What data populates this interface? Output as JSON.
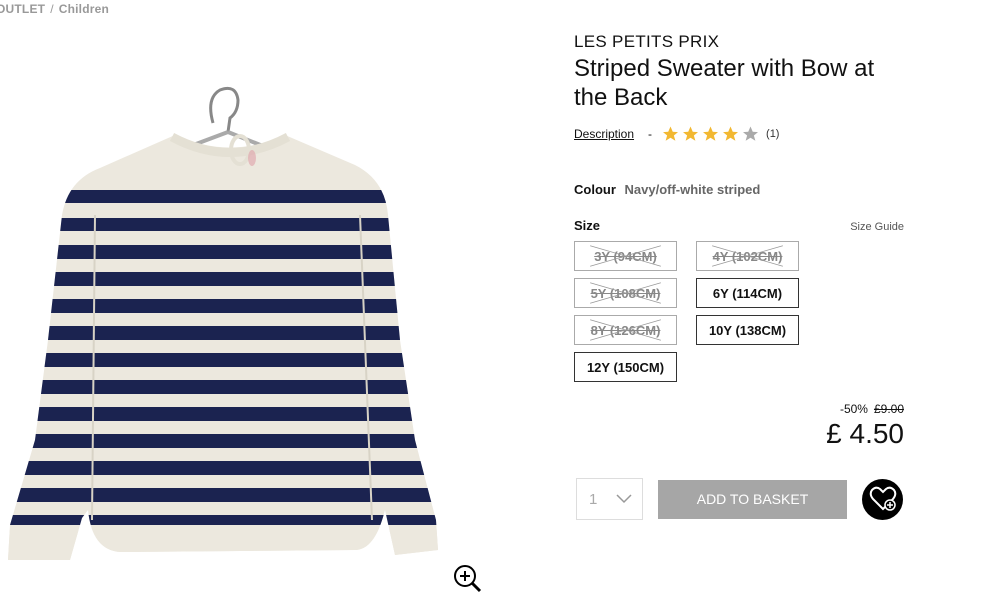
{
  "breadcrumb": {
    "items": [
      "OUTLET",
      "Children"
    ],
    "separator": "/"
  },
  "product": {
    "brand": "LES PETITS PRIX",
    "title": "Striped Sweater with Bow at the Back",
    "description_link": "Description",
    "dash": "-",
    "rating": {
      "stars": 4,
      "max": 5,
      "count_text": "(1)"
    },
    "colour": {
      "label": "Colour",
      "value": "Navy/off-white striped"
    },
    "size": {
      "label": "Size",
      "guide": "Size Guide",
      "options": [
        {
          "label": "3Y (94CM)",
          "available": false
        },
        {
          "label": "4Y (102CM)",
          "available": false
        },
        {
          "label": "5Y (108CM)",
          "available": false
        },
        {
          "label": "6Y (114CM)",
          "available": true
        },
        {
          "label": "8Y (126CM)",
          "available": false
        },
        {
          "label": "10Y (138CM)",
          "available": true
        },
        {
          "label": "12Y (150CM)",
          "available": true
        }
      ]
    },
    "price": {
      "discount": "-50%",
      "old": "£9.00",
      "current": "£ 4.50"
    },
    "quantity": "1",
    "add_to_basket": "ADD TO BASKET"
  },
  "colors": {
    "star_on": "#f2b832",
    "star_off": "#aaaaaa",
    "navy": "#1b2350",
    "cream": "#ece8de",
    "button_grey": "#a6a6a6"
  },
  "icons": [
    "hanger-icon",
    "zoom-in-icon",
    "star-icon",
    "chevron-down-icon",
    "wishlist-heart-plus-icon"
  ]
}
